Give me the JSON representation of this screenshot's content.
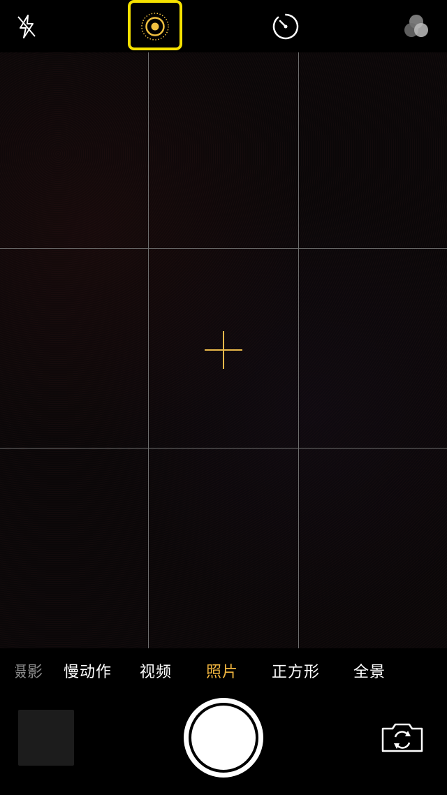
{
  "top_bar": {
    "icons": [
      "flash-off-icon",
      "live-photo-icon",
      "timer-icon",
      "filters-icon"
    ],
    "highlight_color": "#f5e100"
  },
  "viewfinder": {
    "grid": "3x3",
    "focus_color": "#e9b84a"
  },
  "modes": {
    "items": [
      "摄影",
      "慢动作",
      "视频",
      "照片",
      "正方形",
      "全景"
    ],
    "active": "照片",
    "active_color": "#f0b53f"
  },
  "bottom_bar": {
    "icons": [
      "last-photo-thumbnail",
      "shutter-button",
      "switch-camera-icon"
    ]
  }
}
